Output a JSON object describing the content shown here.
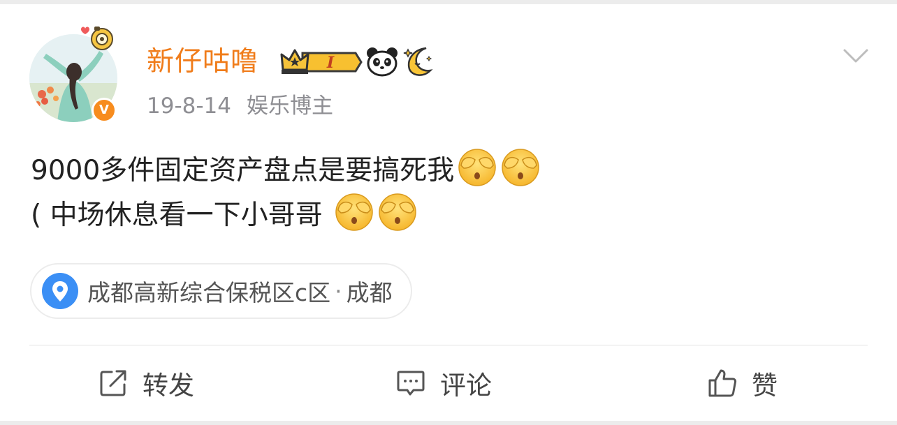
{
  "post": {
    "user": {
      "name": "新仔咕噜",
      "verified_mark": "V",
      "level_badge": "I",
      "badges": [
        "crown-level-icon",
        "panda-icon",
        "sleepy-moon-icon"
      ]
    },
    "time": "19-8-14",
    "identity": "娱乐博主",
    "content": {
      "line1": "9000多件固定资产盘点是要搞死我",
      "line2": "( 中场休息看一下小哥哥 ",
      "emoji": "cover-face-emoji"
    },
    "location": {
      "name": "成都高新综合保税区c区",
      "separator": "·",
      "city": "成都",
      "icon": "location-pin-icon"
    },
    "actions": {
      "repost": "转发",
      "comment": "评论",
      "like": "赞"
    }
  },
  "colors": {
    "username": "#f07c1a",
    "verified": "#f78c1e",
    "location_icon": "#3b8ff5",
    "meta": "#8e8e93",
    "text": "#222222"
  }
}
